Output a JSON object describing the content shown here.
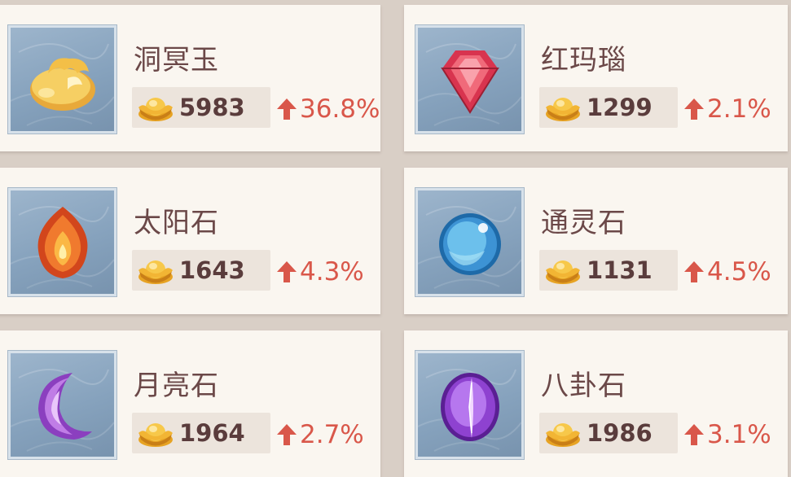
{
  "colors": {
    "up": "#d9574a",
    "name": "#6b4848",
    "price": "#5a3c3c"
  },
  "items": [
    {
      "name": "洞冥玉",
      "price": "5983",
      "change": "36.8%",
      "icon": "jade-icon"
    },
    {
      "name": "红玛瑙",
      "price": "1299",
      "change": "2.1%",
      "icon": "red-agate-icon"
    },
    {
      "name": "太阳石",
      "price": "1643",
      "change": "4.3%",
      "icon": "sunstone-icon"
    },
    {
      "name": "通灵石",
      "price": "1131",
      "change": "4.5%",
      "icon": "spirit-stone-icon"
    },
    {
      "name": "月亮石",
      "price": "1964",
      "change": "2.7%",
      "icon": "moonstone-icon"
    },
    {
      "name": "八卦石",
      "price": "1986",
      "change": "3.1%",
      "icon": "bagua-stone-icon"
    }
  ]
}
